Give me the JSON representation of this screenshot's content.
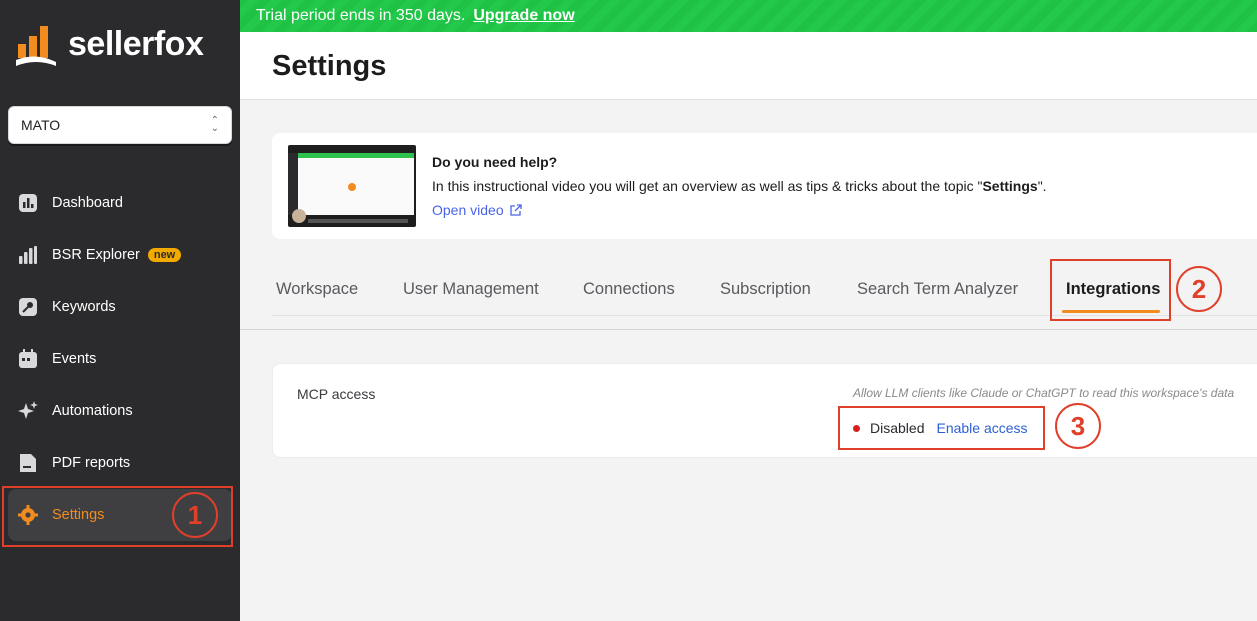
{
  "sidebar": {
    "logo_text": "sellerfox",
    "workspace": "MATO",
    "items": [
      {
        "label": "Dashboard",
        "icon": "chart-box-icon"
      },
      {
        "label": "BSR Explorer",
        "icon": "bar-chart-icon",
        "badge": "new"
      },
      {
        "label": "Keywords",
        "icon": "key-icon"
      },
      {
        "label": "Events",
        "icon": "calendar-icon"
      },
      {
        "label": "Automations",
        "icon": "sparkles-icon"
      },
      {
        "label": "PDF reports",
        "icon": "document-icon"
      },
      {
        "label": "Settings",
        "icon": "gear-icon",
        "active": true
      }
    ]
  },
  "trial": {
    "text": "Trial period ends in 350 days.",
    "link": "Upgrade now"
  },
  "header": {
    "title": "Settings"
  },
  "help": {
    "title": "Do you need help?",
    "text_before": "In this instructional video you will get an overview as well as tips & tricks about the topic \"",
    "text_bold": "Settings",
    "text_after": "\".",
    "link": "Open video"
  },
  "tabs": [
    "Workspace",
    "User Management",
    "Connections",
    "Subscription",
    "Search Term Analyzer",
    "Integrations"
  ],
  "active_tab": "Integrations",
  "mcp": {
    "label": "MCP access",
    "description": "Allow LLM clients like Claude or ChatGPT to read this workspace's data",
    "status": "Disabled",
    "action": "Enable access"
  },
  "annotations": [
    "1",
    "2",
    "3"
  ],
  "colors": {
    "accent": "#f28c1e",
    "trial_green": "#22c94a",
    "sidebar": "#2b2b2d",
    "annotation_red": "#e0402a",
    "link_blue": "#2c5fd6"
  }
}
